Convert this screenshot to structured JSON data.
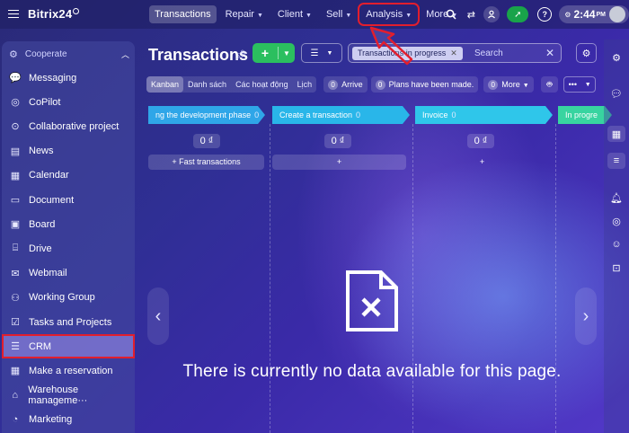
{
  "topbar": {
    "logo": "Bitrix24",
    "nav": [
      {
        "label": "Transactions",
        "active": true,
        "highlight": false,
        "chevron": false
      },
      {
        "label": "Repair",
        "active": false,
        "highlight": false,
        "chevron": true
      },
      {
        "label": "Client",
        "active": false,
        "highlight": false,
        "chevron": true
      },
      {
        "label": "Sell",
        "active": false,
        "highlight": false,
        "chevron": true
      },
      {
        "label": "Analysis",
        "active": false,
        "highlight": true,
        "chevron": true
      },
      {
        "label": "More",
        "active": false,
        "highlight": false,
        "chevron": true
      }
    ],
    "time": "2:44",
    "ampm": "PM",
    "icons": [
      "search-icon",
      "sliders-icon",
      "user-icon",
      "rocket-icon",
      "help-icon",
      "gear-icon"
    ]
  },
  "sidebar": {
    "group_label": "Cooperate",
    "items": [
      {
        "label": "Messaging",
        "icon": "chat-icon",
        "glyph": "💬"
      },
      {
        "label": "CoPilot",
        "icon": "copilot-icon",
        "glyph": "◎"
      },
      {
        "label": "Collaborative project",
        "icon": "project-icon",
        "glyph": "⊙"
      },
      {
        "label": "News",
        "icon": "news-icon",
        "glyph": "▤"
      },
      {
        "label": "Calendar",
        "icon": "calendar-icon",
        "glyph": "▦"
      },
      {
        "label": "Document",
        "icon": "document-icon",
        "glyph": "▭"
      },
      {
        "label": "Board",
        "icon": "board-icon",
        "glyph": "▣"
      },
      {
        "label": "Drive",
        "icon": "drive-icon",
        "glyph": "⌸"
      },
      {
        "label": "Webmail",
        "icon": "mail-icon",
        "glyph": "✉"
      },
      {
        "label": "Working Group",
        "icon": "group-icon",
        "glyph": "⚇"
      },
      {
        "label": "Tasks and Projects",
        "icon": "tasks-icon",
        "glyph": "☑"
      },
      {
        "label": "CRM",
        "icon": "crm-icon",
        "glyph": "☰"
      },
      {
        "label": "Make a reservation",
        "icon": "reservation-icon",
        "glyph": "▦"
      },
      {
        "label": "Warehouse manageme···",
        "icon": "warehouse-icon",
        "glyph": "⌂"
      },
      {
        "label": "Marketing",
        "icon": "marketing-icon",
        "glyph": "◔"
      }
    ],
    "active_index": 11
  },
  "toolbar": {
    "title": "Transactions",
    "filter_chip": "Transactions in progress",
    "search_placeholder": "Search"
  },
  "views": {
    "tabs": [
      "Kanban",
      "Danh sách",
      "Các hoạt động",
      "Lịch"
    ],
    "active_tab": 0,
    "arrive_count": "0",
    "arrive_label": "Arrive",
    "plans_count": "0",
    "plans_label": "Plans have been made.",
    "more_count": "0",
    "more_label": "More"
  },
  "kanban": {
    "stages": [
      {
        "name": "ng the development phase",
        "count": "0",
        "color": "#2fa6e8",
        "sum": "0 ₫",
        "action": "+ Fast transactions"
      },
      {
        "name": "Create a transaction",
        "count": "0",
        "color": "#29b6e9",
        "sum": "0 ₫",
        "action": "+"
      },
      {
        "name": "Invoice",
        "count": "0",
        "color": "#2fc6ea",
        "sum": "0 ₫",
        "action": "+"
      },
      {
        "name": "In progre",
        "count": "",
        "color": "#38d4a0",
        "sum": "",
        "action": ""
      }
    ]
  },
  "empty_state": {
    "message": "There is currently no data available for this page."
  },
  "colors": {
    "accent_green": "#2bbf5f",
    "highlight_red": "#e21e2d"
  }
}
